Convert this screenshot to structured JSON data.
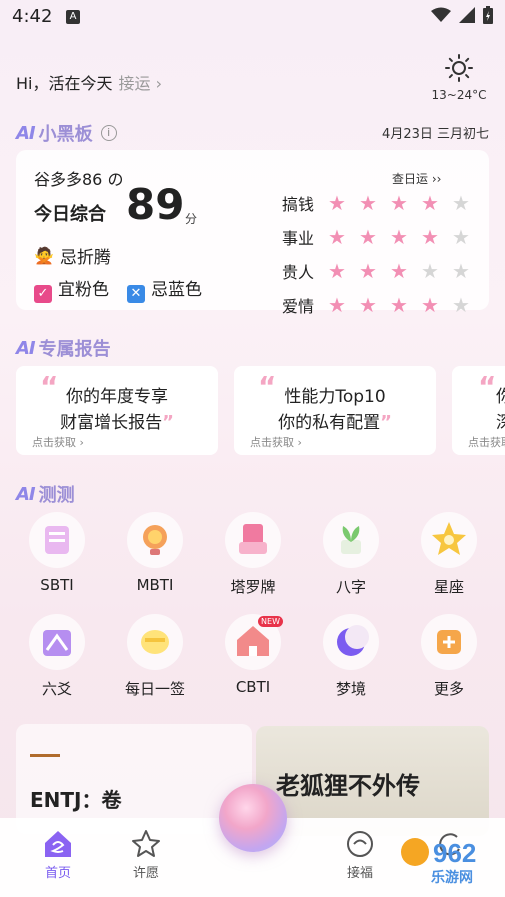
{
  "status": {
    "time": "4:42",
    "badge": "A"
  },
  "greeting": {
    "text": "Hi，活在今天",
    "luck_link": "接运 ›"
  },
  "weather": {
    "icon": "sun-icon",
    "temp": "13~24°C"
  },
  "blackboard": {
    "title": "小黑板",
    "date": "4月23日 三月初七"
  },
  "fortune": {
    "user": "谷多多86 の",
    "score_label": "今日综合",
    "score": "89",
    "score_unit": "分",
    "avoid": "忌折腾",
    "good_color": "宜粉色",
    "bad_color": "忌蓝色",
    "check_day": "查日运 ››",
    "ratings": [
      {
        "label": "搞钱",
        "stars": 4
      },
      {
        "label": "事业",
        "stars": 4
      },
      {
        "label": "贵人",
        "stars": 3
      },
      {
        "label": "爱情",
        "stars": 4
      }
    ],
    "star_color": "#f28fb4"
  },
  "reports": {
    "title": "专属报告",
    "cards": [
      {
        "line1": "你的年度专享",
        "line2": "财富增长报告",
        "get": "点击获取 ›"
      },
      {
        "line1": "性能力Top10",
        "line2": "你的私有配置",
        "get": "点击获取 ›"
      },
      {
        "line1": "你",
        "line2": "深",
        "get": "点击获取"
      }
    ]
  },
  "tests": {
    "title": "测测",
    "items": [
      {
        "label": "SBTI",
        "icon": "sbti-icon"
      },
      {
        "label": "MBTI",
        "icon": "lightbulb-icon"
      },
      {
        "label": "塔罗牌",
        "icon": "tarot-card-icon"
      },
      {
        "label": "八字",
        "icon": "sprout-icon"
      },
      {
        "label": "星座",
        "icon": "star-icon"
      },
      {
        "label": "六爻",
        "icon": "hexagram-icon"
      },
      {
        "label": "每日一签",
        "icon": "fortune-stick-icon"
      },
      {
        "label": "CBTI",
        "icon": "house-icon",
        "badge": "NEW"
      },
      {
        "label": "梦境",
        "icon": "moon-icon"
      },
      {
        "label": "更多",
        "icon": "more-icon"
      }
    ]
  },
  "article": {
    "left_title": "ENTJ：卷",
    "image_title": "老狐狸不外传"
  },
  "nav": {
    "items": [
      {
        "label": "首页",
        "icon": "home-icon",
        "active": true
      },
      {
        "label": "许愿",
        "icon": "wish-star-icon"
      },
      {
        "label": "接福",
        "icon": "blessing-icon"
      },
      {
        "label": "",
        "icon": "profile-icon"
      }
    ]
  },
  "watermark": {
    "text": "962.NET",
    "sub": "乐游网"
  }
}
